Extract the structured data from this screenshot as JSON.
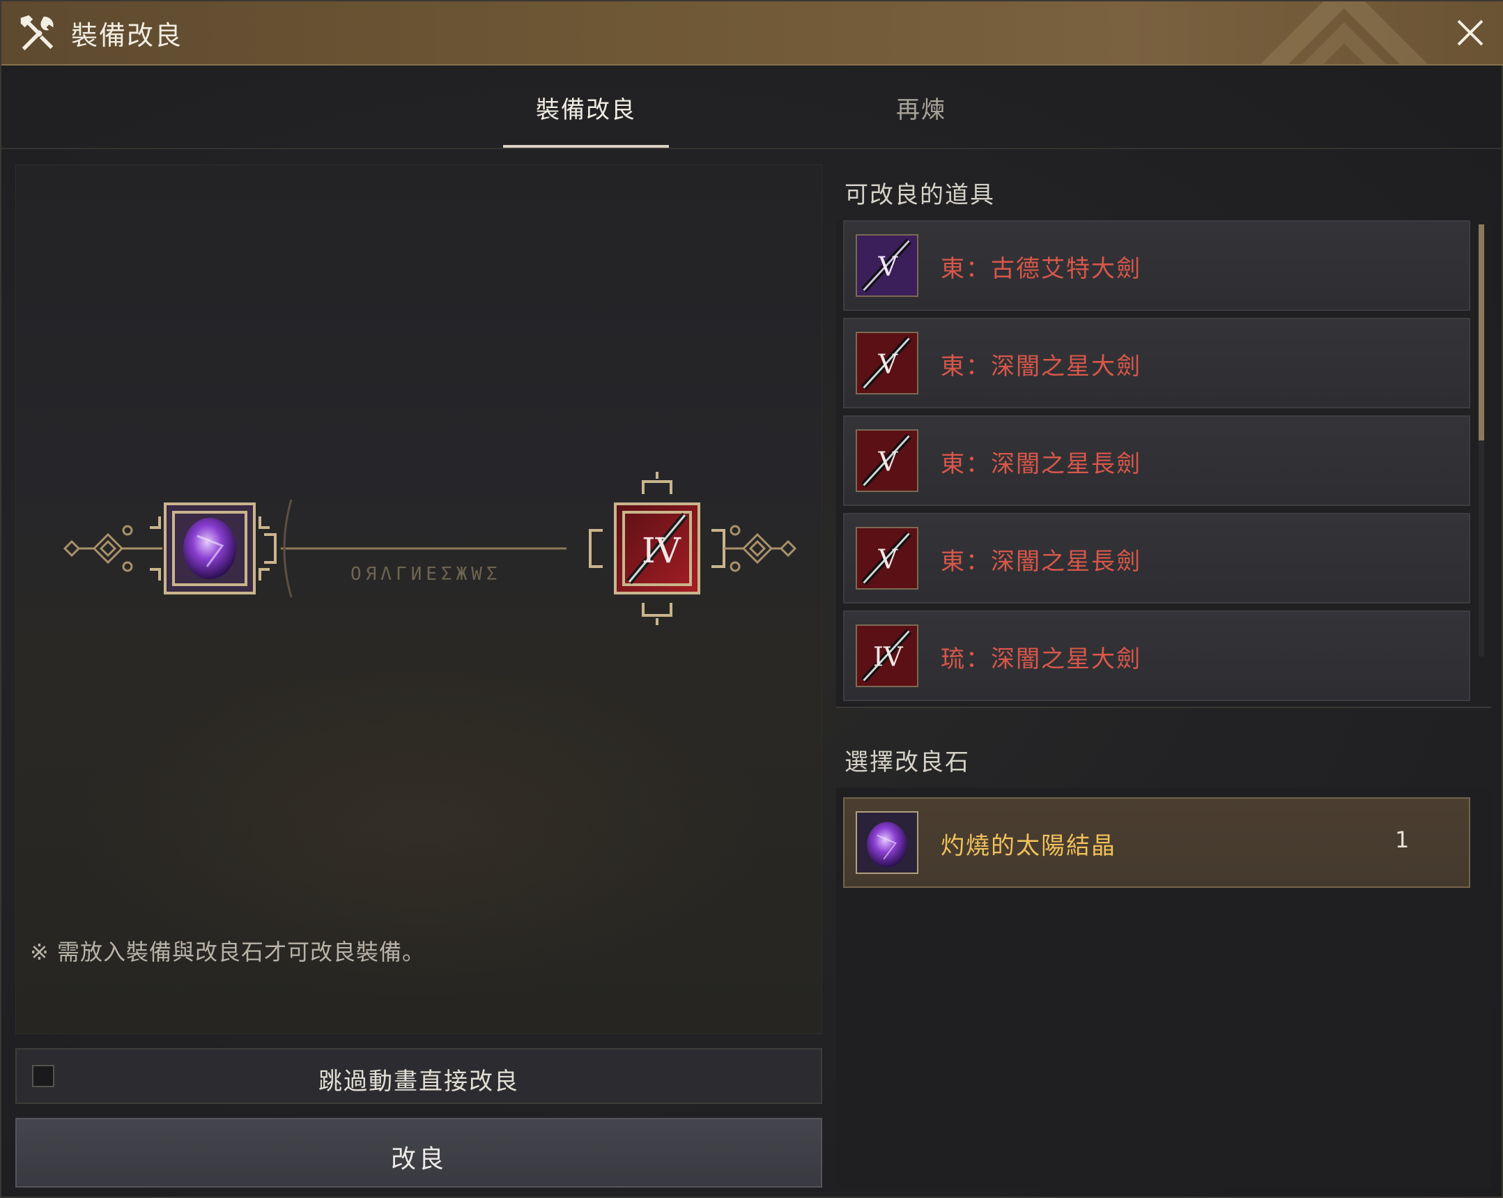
{
  "window": {
    "title": "裝備改良",
    "close_icon": "close-icon"
  },
  "tabs": [
    {
      "label": "裝備改良",
      "active": true
    },
    {
      "label": "再煉",
      "active": false
    }
  ],
  "preview": {
    "notice": "※ 需放入裝備與改良石才可改良裝備。",
    "source_stone_icon": "purple-crystal-icon",
    "target_item_icon": "red-sword-icon",
    "target_item_tier": "IV",
    "rune_text": "OЯΛΓИЕΣЖWΣ"
  },
  "skip_animation": {
    "label": "跳過動畫直接改良",
    "checked": false
  },
  "refine_button": {
    "label": "改良"
  },
  "items_section": {
    "title": "可改良的道具",
    "items": [
      {
        "name": "東：古德艾特大劍",
        "tier": "V",
        "color": "#8a3fd1"
      },
      {
        "name": "東：深闇之星大劍",
        "tier": "V",
        "color": "#c0242a"
      },
      {
        "name": "東：深闇之星長劍",
        "tier": "V",
        "color": "#c0242a"
      },
      {
        "name": "東：深闇之星長劍",
        "tier": "V",
        "color": "#c0242a"
      },
      {
        "name": "琉：深闇之星大劍",
        "tier": "IV",
        "color": "#c0242a"
      }
    ]
  },
  "stone_section": {
    "title": "選擇改良石",
    "stone": {
      "name": "灼燒的太陽結晶",
      "count": "1"
    }
  },
  "colors": {
    "accent_gold": "#8a7148",
    "item_red": "#d9574a",
    "stone_gold": "#f0c15a"
  }
}
